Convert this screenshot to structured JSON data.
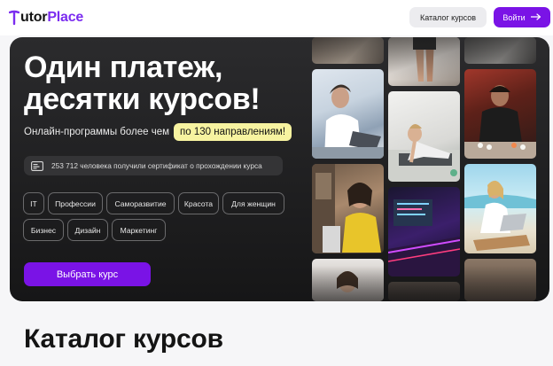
{
  "header": {
    "logo_prefix": "T",
    "logo_text": "utor",
    "logo_accent": "Place",
    "catalog_button": "Каталог курсов",
    "login_button": "Войти"
  },
  "hero": {
    "title_line1": "Один платеж,",
    "title_line2": "десятки курсов!",
    "subtitle": "Онлайн-программы более чем",
    "highlight": "по 130 направлениям!",
    "certificate_text": "253 712 человека получили сертификат о прохождении курса",
    "tags": [
      "IT",
      "Профессии",
      "Саморазвитие",
      "Красота",
      "Для женщин",
      "Бизнес",
      "Дизайн",
      "Маркетинг"
    ],
    "cta": "Выбрать курс"
  },
  "catalog": {
    "title": "Каталог курсов"
  },
  "colors": {
    "accent": "#7a13e6",
    "highlight": "#f7f3a0",
    "hero_bg": "#1f1f20"
  },
  "icons": {
    "login_arrow": "arrow-right-icon",
    "certificate": "certificate-icon"
  }
}
